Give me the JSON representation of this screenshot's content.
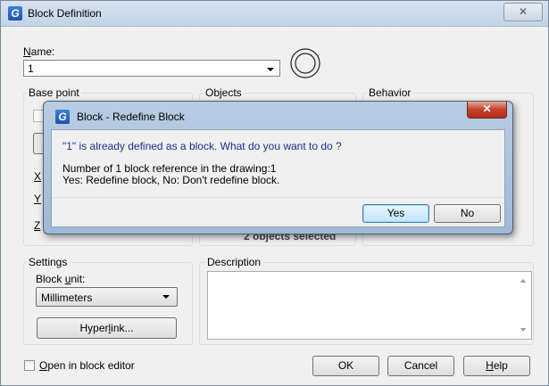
{
  "window": {
    "title": "Block Definition",
    "close": "✕"
  },
  "name": {
    "label_ul": "N",
    "label_rest": "ame:",
    "value": "1"
  },
  "groups": {
    "base_point": "Base point",
    "objects": "Objects",
    "behavior": "Behavior",
    "settings": "Settings",
    "description": "Description"
  },
  "base_point": {
    "x": "X",
    "y": "Y",
    "z": "Z"
  },
  "objects": {
    "status": "2 objects selected"
  },
  "settings": {
    "block_unit_pre": "Block ",
    "block_unit_ul": "u",
    "block_unit_post": "nit:",
    "unit_value": "Millimeters",
    "hyperlink_pre": "Hyper",
    "hyperlink_ul": "l",
    "hyperlink_post": "ink..."
  },
  "footer": {
    "open_editor_ul": "O",
    "open_editor_rest": "pen in block editor",
    "ok": "OK",
    "cancel": "Cancel",
    "help_ul": "H",
    "help_rest": "elp"
  },
  "dialog": {
    "title": "Block - Redefine Block",
    "close": "✕",
    "message": "\"1\" is already defined as a block. What do you want to do ?",
    "detail_line1": "Number of 1 block reference in the drawing:1",
    "detail_line2": "Yes: Redefine block, No: Don't redefine block.",
    "yes": "Yes",
    "no": "No"
  }
}
